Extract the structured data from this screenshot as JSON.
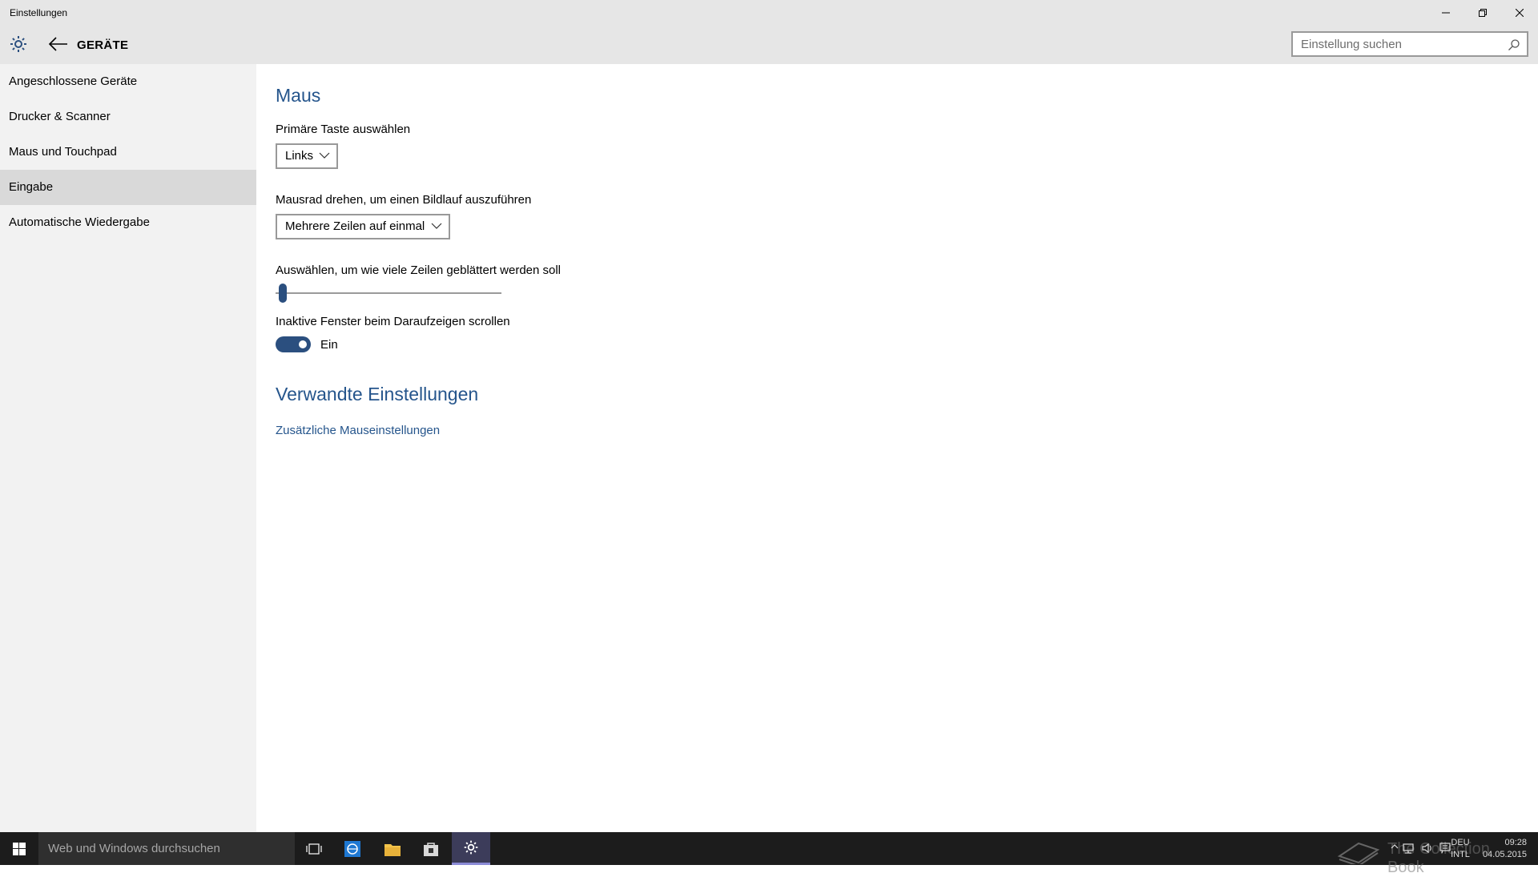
{
  "window": {
    "title": "Einstellungen"
  },
  "header": {
    "breadcrumb": "GERÄTE",
    "search_placeholder": "Einstellung suchen"
  },
  "sidebar": {
    "items": [
      {
        "label": "Angeschlossene Geräte",
        "selected": false
      },
      {
        "label": "Drucker & Scanner",
        "selected": false
      },
      {
        "label": "Maus und Touchpad",
        "selected": false
      },
      {
        "label": "Eingabe",
        "selected": true
      },
      {
        "label": "Automatische Wiedergabe",
        "selected": false
      }
    ]
  },
  "main": {
    "title": "Maus",
    "primary_button": {
      "label": "Primäre Taste auswählen",
      "value": "Links"
    },
    "wheel_scroll": {
      "label": "Mausrad drehen, um einen Bildlauf auszuführen",
      "value": "Mehrere Zeilen auf einmal"
    },
    "lines_slider": {
      "label": "Auswählen, um wie viele Zeilen geblättert werden soll",
      "fraction": 0.0
    },
    "inactive_scroll": {
      "label": "Inaktive Fenster beim Daraufzeigen scrollen",
      "state": "Ein",
      "on": true
    },
    "related": {
      "title": "Verwandte Einstellungen",
      "link": "Zusätzliche Mauseinstellungen"
    }
  },
  "taskbar": {
    "search_placeholder": "Web und Windows durchsuchen",
    "language": {
      "line1": "DEU",
      "line2": "INTL"
    },
    "clock": {
      "time": "09:28",
      "date": "04.05.2015"
    },
    "watermark": "The Collection Book"
  },
  "colors": {
    "accent": "#25558c",
    "toggle": "#2b4f7f",
    "sidebar": "#f2f2f2",
    "titlebar": "#e6e6e6",
    "taskbar": "#1c1c1c"
  },
  "icons": [
    "gear-icon",
    "back-arrow-icon",
    "search-icon",
    "minimize-icon",
    "restore-icon",
    "close-icon",
    "chevron-down-icon",
    "windows-start-icon",
    "task-view-icon",
    "ie-icon",
    "file-explorer-icon",
    "store-icon",
    "settings-gear-icon",
    "network-icon",
    "volume-icon",
    "action-center-icon"
  ]
}
